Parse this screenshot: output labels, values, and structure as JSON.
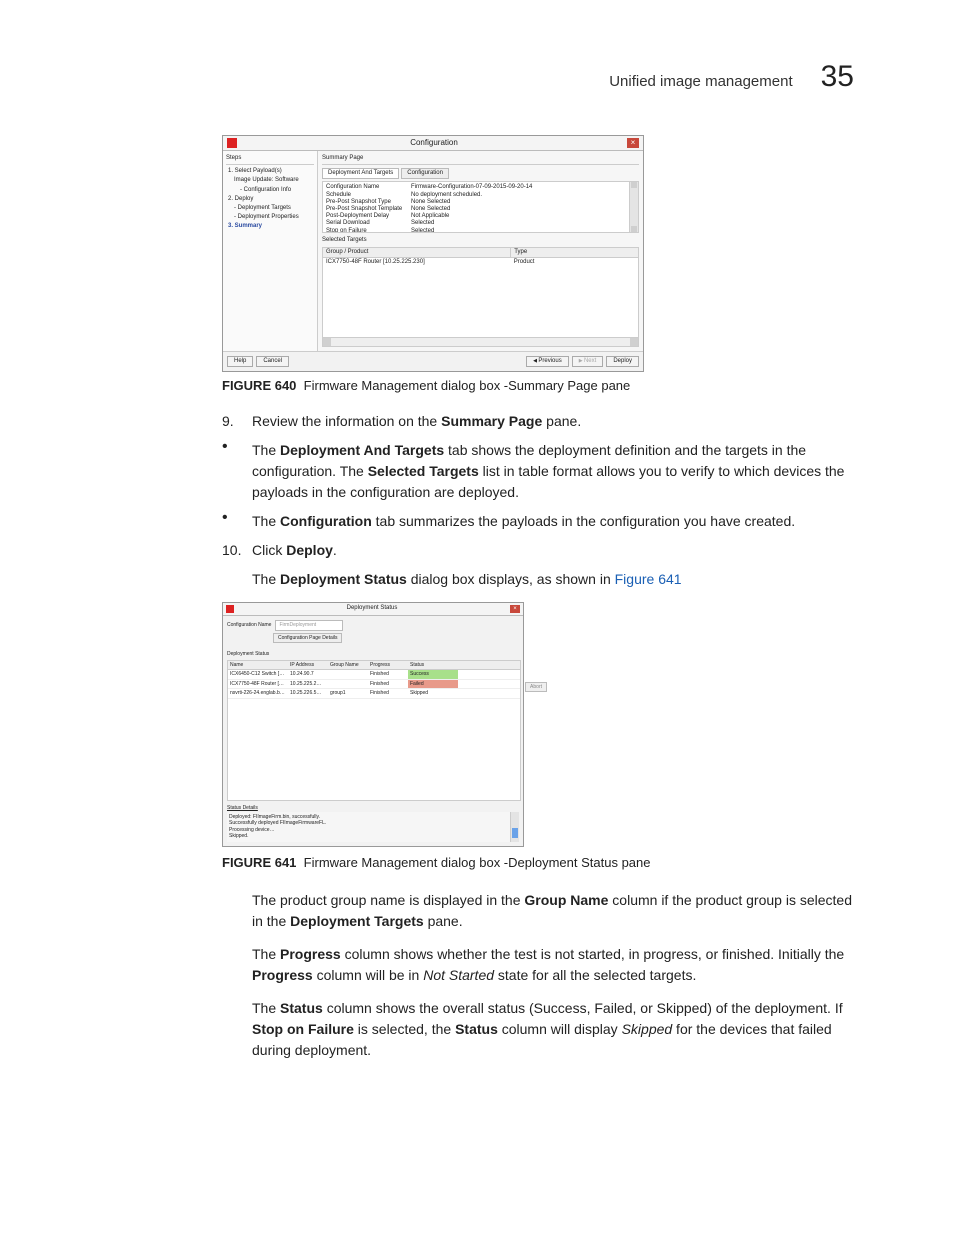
{
  "header": {
    "title": "Unified image management",
    "page_number": "35"
  },
  "figure640": {
    "dialog_title": "Configuration",
    "close_glyph": "×",
    "sidebar_title": "Steps",
    "sidebar": [
      {
        "text": "1. Select Payload(s)",
        "indent": 0
      },
      {
        "text": "Image Update: Software",
        "indent": 1
      },
      {
        "text": "- Configuration Info",
        "indent": 2
      },
      {
        "text": "2. Deploy",
        "indent": 0
      },
      {
        "text": "- Deployment Targets",
        "indent": 1
      },
      {
        "text": "- Deployment Properties",
        "indent": 1
      },
      {
        "text": "3. Summary",
        "indent": 0,
        "active": true
      }
    ],
    "section_title": "Summary Page",
    "tab_dep_targets": "Deployment And Targets",
    "tab_config": "Configuration",
    "def_rows": [
      {
        "k": "Configuration Name",
        "v": "Firmware-Configuration-07-09-2015-09-20-14"
      },
      {
        "k": "Schedule",
        "v": "No deployment scheduled."
      },
      {
        "k": "Pre-Post Snapshot Type",
        "v": "None Selected"
      },
      {
        "k": "Pre-Post Snapshot Template",
        "v": "None Selected"
      },
      {
        "k": "Post-Deployment Delay",
        "v": "Not Applicable"
      },
      {
        "k": "Serial Download",
        "v": "Selected"
      },
      {
        "k": "Stop on Failure",
        "v": "Selected"
      }
    ],
    "sel_title": "Selected Targets",
    "col_group_product": "Group / Product",
    "col_type": "Type",
    "sel_row_product": "ICX7750-48F Router [10.25.225.230]",
    "sel_row_type": "Product",
    "btn_help": "Help",
    "btn_cancel": "Cancel",
    "btn_prev": "Previous",
    "btn_next": "Next",
    "btn_deploy": "Deploy",
    "caption_label": "FIGURE 640",
    "caption_text": "Firmware Management dialog box -Summary Page pane"
  },
  "body": {
    "step9_num": "9.",
    "step9_1": "Review the information on the ",
    "step9_b1": "Summary Page",
    "step9_2": " pane.",
    "bul1_1": "The ",
    "bul1_b1": "Deployment And Targets",
    "bul1_2": " tab shows the deployment definition and the targets in the configuration. The ",
    "bul1_b2": "Selected Targets",
    "bul1_3": " list in table format allows you to verify to which devices the payloads in the configuration are deployed.",
    "bul2_1": "The ",
    "bul2_b1": "Configuration",
    "bul2_2": " tab summarizes the payloads in the configuration you have created.",
    "step10_num": "10.",
    "step10_1": "Click ",
    "step10_b1": "Deploy",
    "step10_2": ".",
    "step10_sub_1": "The ",
    "step10_sub_b1": "Deployment Status",
    "step10_sub_2": " dialog box displays, as shown in ",
    "step10_sub_link": "Figure 641",
    "gn_1": "The product group name is displayed in the ",
    "gn_b1": "Group Name",
    "gn_2": " column if the product group is selected in the ",
    "gn_b2": "Deployment Targets",
    "gn_3": " pane.",
    "prog_1": "The ",
    "prog_b1": "Progress",
    "prog_2": " column shows whether the test is not started, in progress, or finished. Initially the ",
    "prog_b2": "Progress",
    "prog_3": " column will be in ",
    "prog_i1": "Not Started",
    "prog_4": " state for all the selected targets.",
    "stat_1": "The ",
    "stat_b1": "Status",
    "stat_2": " column shows the overall status (Success, Failed, or Skipped) of the deployment. If ",
    "stat_b2": "Stop on Failure",
    "stat_3": " is selected, the ",
    "stat_b3": "Status",
    "stat_4": " column will display ",
    "stat_i1": "Skipped",
    "stat_5": " for the devices that failed during deployment.",
    "bullet": "•"
  },
  "figure641": {
    "dialog_title": "Deployment Status",
    "close_glyph": "×",
    "cfg_name_label": "Configuration Name",
    "cfg_name_value": "FirmDeployment",
    "cfg_btn": "Configuration Page Details",
    "ds_title": "Deployment Status",
    "col_name": "Name",
    "col_ip": "IP Address",
    "col_group": "Group Name",
    "col_progress": "Progress",
    "col_status": "Status",
    "rows": [
      {
        "name": "ICX6450-C12 Switch [1…",
        "ip": "10.24.90.7",
        "grp": "",
        "prog": "Finished",
        "stat": "Success",
        "cls": "success"
      },
      {
        "name": "ICX7750-48F Router [10…",
        "ip": "10.25.225.2…",
        "grp": "",
        "prog": "Finished",
        "stat": "Failed",
        "cls": "failed"
      },
      {
        "name": "nsvrti-226-24.englab.br…",
        "ip": "10.25.226.5…",
        "grp": "group1",
        "prog": "Finished",
        "stat": "Skipped",
        "cls": ""
      }
    ],
    "abort": "Abort",
    "sd_title": "Status Details",
    "sd_lines": [
      "Deployed: FIImageFirm.bin, successfully.",
      "Successfully deployed FIImageFirmwareFL.",
      "Processing device…",
      "Skipped."
    ],
    "caption_label": "FIGURE 641",
    "caption_text": "Firmware Management dialog box -Deployment Status pane"
  }
}
